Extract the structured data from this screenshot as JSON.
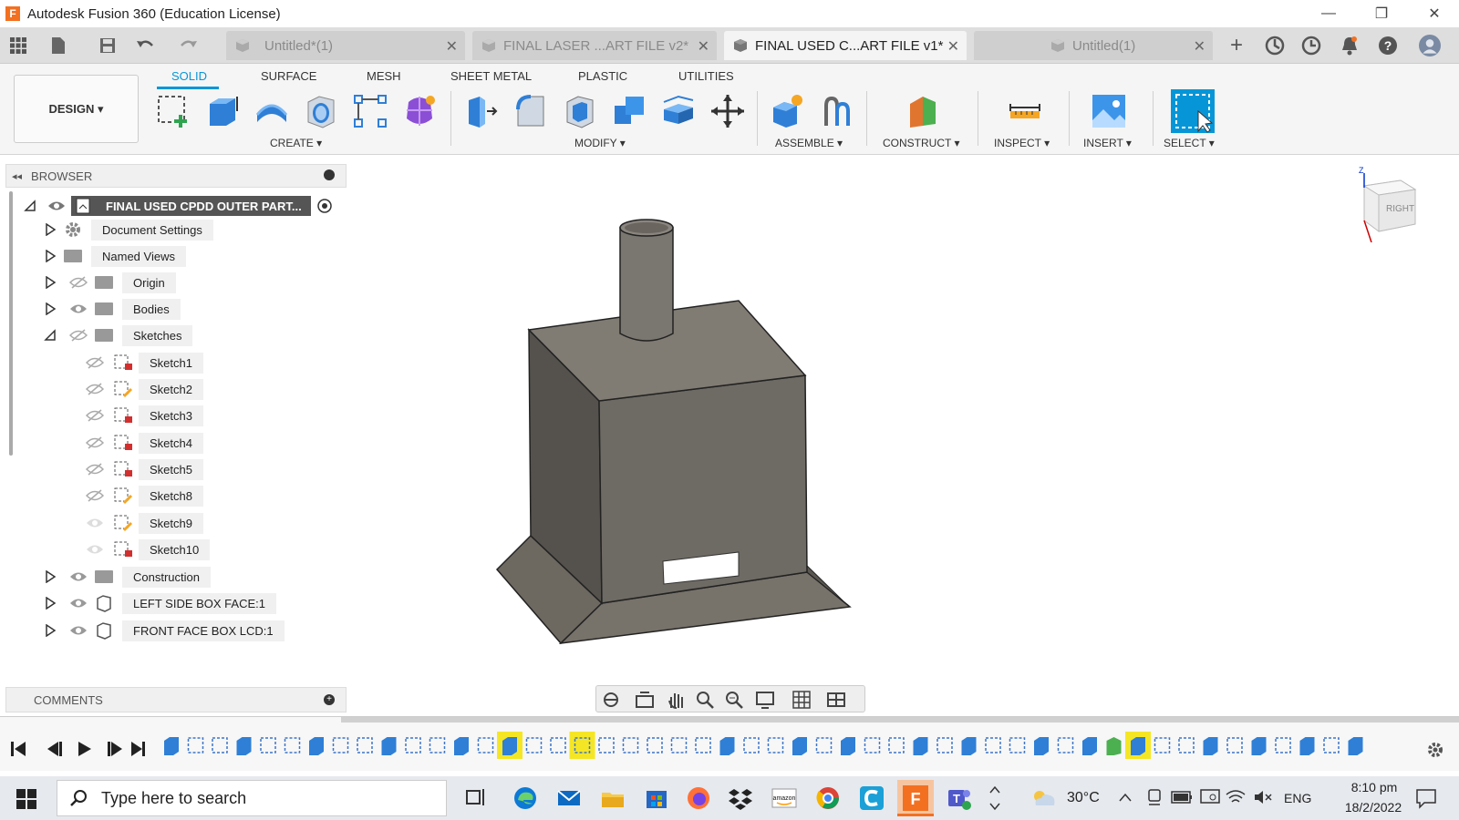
{
  "titlebar": {
    "title": "Autodesk Fusion 360 (Education License)",
    "logo_letter": "F"
  },
  "tabs": [
    {
      "label": "Untitled*(1)"
    },
    {
      "label": "FINAL LASER ...ART FILE v2*"
    },
    {
      "label": "FINAL USED C...ART FILE v1*"
    },
    {
      "label": "Untitled(1)"
    }
  ],
  "ribbon": {
    "workspace": "DESIGN ▾",
    "tabs": [
      "SOLID",
      "SURFACE",
      "MESH",
      "SHEET METAL",
      "PLASTIC",
      "UTILITIES"
    ],
    "groups": [
      "CREATE ▾",
      "MODIFY ▾",
      "ASSEMBLE ▾",
      "CONSTRUCT ▾",
      "INSPECT ▾",
      "INSERT ▾",
      "SELECT ▾"
    ]
  },
  "browser": {
    "header": "BROWSER",
    "root": "FINAL USED CPDD OUTER PART...",
    "items": [
      "Document Settings",
      "Named Views",
      "Origin",
      "Bodies",
      "Sketches",
      "Sketch1",
      "Sketch2",
      "Sketch3",
      "Sketch4",
      "Sketch5",
      "Sketch8",
      "Sketch9",
      "Sketch10",
      "Construction",
      "LEFT SIDE BOX FACE:1",
      "FRONT FACE  BOX LCD:1"
    ]
  },
  "comments": {
    "label": "COMMENTS"
  },
  "viewcube": {
    "face": "RIGHT",
    "axis": "Z"
  },
  "taskbar": {
    "search_placeholder": "Type here to search",
    "weather": "30°C",
    "lang": "ENG",
    "time": "8:10 pm",
    "date": "18/2/2022"
  }
}
